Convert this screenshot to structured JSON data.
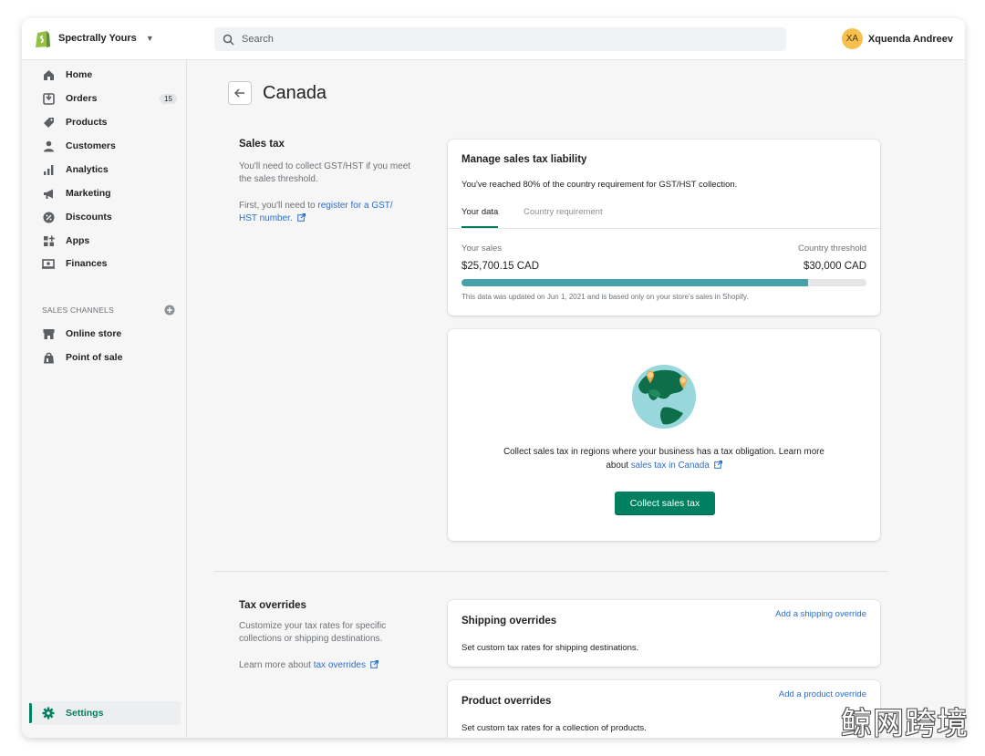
{
  "header": {
    "store_name": "Spectrally Yours",
    "search_placeholder": "Search",
    "user_initials": "XA",
    "user_name": "Xquenda Andreev"
  },
  "sidebar": {
    "items": [
      {
        "label": "Home",
        "icon": "home-icon"
      },
      {
        "label": "Orders",
        "icon": "orders-icon",
        "badge": "15"
      },
      {
        "label": "Products",
        "icon": "tag-icon"
      },
      {
        "label": "Customers",
        "icon": "person-icon"
      },
      {
        "label": "Analytics",
        "icon": "bar-chart-icon"
      },
      {
        "label": "Marketing",
        "icon": "megaphone-icon"
      },
      {
        "label": "Discounts",
        "icon": "discount-icon"
      },
      {
        "label": "Apps",
        "icon": "apps-icon"
      },
      {
        "label": "Finances",
        "icon": "finances-icon"
      }
    ],
    "sales_channels_heading": "SALES CHANNELS",
    "channels": [
      {
        "label": "Online store",
        "icon": "store-icon"
      },
      {
        "label": "Point of sale",
        "icon": "pos-icon"
      }
    ],
    "settings_label": "Settings"
  },
  "page": {
    "title": "Canada",
    "sales_tax": {
      "heading": "Sales tax",
      "desc": "You'll need to collect GST/HST if you meet the sales threshold.",
      "register_prefix": "First, you'll need to ",
      "register_link_line1": "register for a GST/",
      "register_link_line2": "HST number."
    },
    "liability_card": {
      "title": "Manage sales tax liability",
      "message": "You've reached 80% of the country requirement for GST/HST collection.",
      "tabs": [
        "Your data",
        "Country requirement"
      ],
      "your_sales_label": "Your sales",
      "your_sales_value": "$25,700.15 CAD",
      "threshold_label": "Country threshold",
      "threshold_value": "$30,000 CAD",
      "progress_fraction": 0.8567,
      "footnote": "This data was updated on Jun 1, 2021 and is based only on your store's sales in Shopify."
    },
    "collect_card": {
      "text_line1": "Collect sales tax in regions where your business has a tax obligation. Learn more",
      "text_line2_prefix": "about ",
      "text_line2_link": "sales tax in Canada",
      "button_label": "Collect sales tax"
    },
    "tax_overrides": {
      "heading": "Tax overrides",
      "desc": "Customize your tax rates for specific collections or shipping destinations.",
      "learn_prefix": "Learn more about ",
      "learn_link": "tax overrides"
    },
    "shipping_card": {
      "title": "Shipping overrides",
      "link": "Add a shipping override",
      "text": "Set custom tax rates for shipping destinations."
    },
    "product_card": {
      "title": "Product overrides",
      "link": "Add a product override",
      "text": "Set custom tax rates for a collection of products."
    }
  },
  "watermark": "鲸网跨境",
  "colors": {
    "accent": "#008060",
    "link": "#2c6ecb",
    "progress": "#47a1a8"
  }
}
